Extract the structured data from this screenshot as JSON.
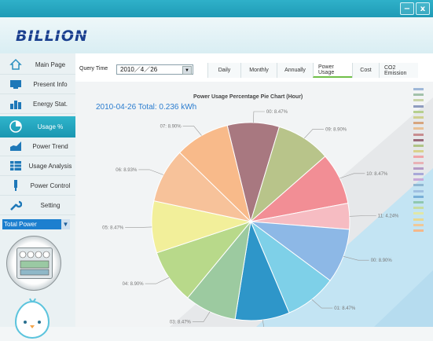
{
  "window": {
    "minimize_glyph": "−",
    "close_glyph": "x"
  },
  "header": {
    "logo": "BILLION"
  },
  "sidebar": {
    "items": [
      {
        "label": "Main Page",
        "icon": "home-icon"
      },
      {
        "label": "Present Info",
        "icon": "monitor-icon"
      },
      {
        "label": "Energy Stat.",
        "icon": "bar-chart-icon"
      },
      {
        "label": "Usage %",
        "icon": "pie-icon",
        "active": true
      },
      {
        "label": "Power Trend",
        "icon": "trend-icon"
      },
      {
        "label": "Usage Analysis",
        "icon": "table-icon"
      },
      {
        "label": "Power Control",
        "icon": "plug-icon"
      },
      {
        "label": "Setting",
        "icon": "wrench-icon"
      }
    ],
    "power_select": "Total Power"
  },
  "toolbar": {
    "query_label": "Query Time",
    "query_value": "2010／4／26",
    "tabs": [
      "Daily",
      "Monthly",
      "Annually",
      "Power Usage",
      "Cost",
      "CO2 Emission"
    ],
    "active_tab": "Power Usage"
  },
  "chart_header": {
    "total": "2010-04-26 Total: 0.236 kWh"
  },
  "chart_data": {
    "type": "pie",
    "title": "Power Usage Percentage Pie Chart (Hour)",
    "slices": [
      {
        "label": "00: 8.47%",
        "value": 8.47,
        "color": "#a87880"
      },
      {
        "label": "09: 8.90%",
        "value": 8.9,
        "color": "#b8c48a"
      },
      {
        "label": "10: 8.47%",
        "value": 8.47,
        "color": "#f28e95"
      },
      {
        "label": "11: 4.24%",
        "value": 4.24,
        "color": "#f6bcc2"
      },
      {
        "label": "00: 8.90%",
        "value": 8.9,
        "color": "#8db8e6"
      },
      {
        "label": "01: 8.47%",
        "value": 8.47,
        "color": "#7ed0e8"
      },
      {
        "label": "02: 8.88%",
        "value": 8.88,
        "color": "#2e96c9"
      },
      {
        "label": "03: 8.47%",
        "value": 8.47,
        "color": "#9ccaa0"
      },
      {
        "label": "04: 8.90%",
        "value": 8.9,
        "color": "#b8d98a"
      },
      {
        "label": "05: 8.47%",
        "value": 8.47,
        "color": "#f2ef9a"
      },
      {
        "label": "06: 8.93%",
        "value": 8.93,
        "color": "#f7c29a"
      },
      {
        "label": "07: 8.90%",
        "value": 8.9,
        "color": "#f8ba8a"
      }
    ],
    "legend_colors": [
      "#9fb8d8",
      "#a3c2ab",
      "#c9d4a8",
      "#8f9cbf",
      "#b6d08f",
      "#cfd08f",
      "#d7a57e",
      "#e9c197",
      "#c88d90",
      "#9a6a7a",
      "#b0c487",
      "#d9d28c",
      "#f0a5a9",
      "#e9b2b5",
      "#b59bc7",
      "#a8a8d8",
      "#c8a8d8",
      "#8fb7d2",
      "#a0c0e0",
      "#7ab0d8",
      "#90c8b0",
      "#c8dca0",
      "#e0e8a8",
      "#e8d890",
      "#f0c898",
      "#f4b88a"
    ]
  }
}
